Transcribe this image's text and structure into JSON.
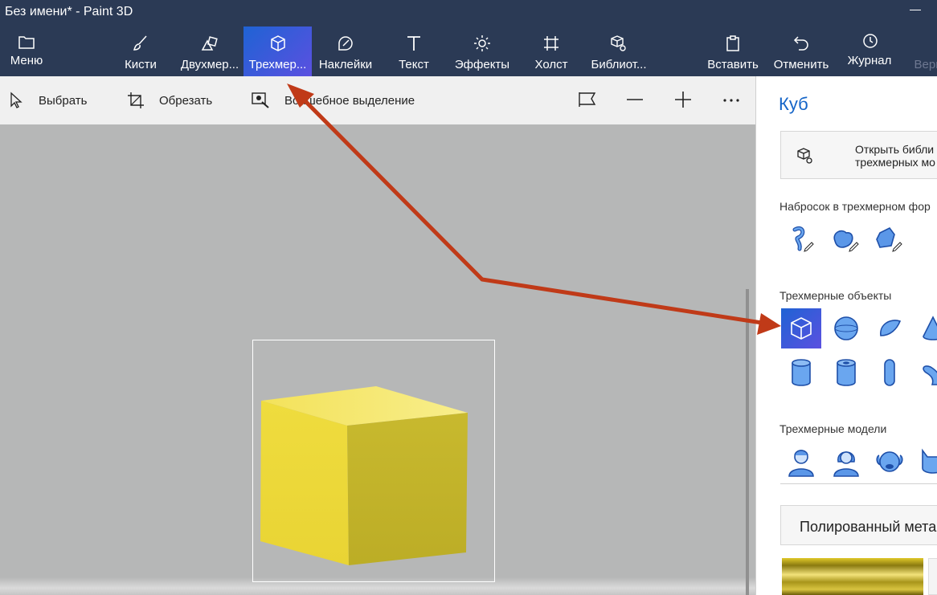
{
  "window": {
    "title": "Без имени* - Paint 3D"
  },
  "ribbon": {
    "menu": "Меню",
    "brushes": "Кисти",
    "shapes2d": "Двухмер...",
    "shapes3d": "Трехмер...",
    "stickers": "Наклейки",
    "text": "Текст",
    "effects": "Эффекты",
    "canvas": "Холст",
    "library": "Библиот...",
    "paste": "Вставить",
    "undo": "Отменить",
    "history": "Журнал",
    "redo": "Верн"
  },
  "toolbar": {
    "select": "Выбрать",
    "crop": "Обрезать",
    "magic_select": "Волшебное выделение"
  },
  "panel": {
    "title": "Куб",
    "library_button": "Открыть библи\nтрехмерных мо",
    "section_sketch": "Набросок в трехмерном фор",
    "section_objects": "Трехмерные объекты",
    "section_models": "Трехмерные модели",
    "material": "Полированный мета"
  },
  "colors": {
    "ribbon_bg": "#2b3a55",
    "accent": "#1f63d4",
    "arrow": "#c03a18",
    "cube_top": "#f5e878",
    "cube_front": "#efdb3b",
    "cube_side": "#c2b22a"
  },
  "icons": [
    "folder-icon",
    "brush-icon",
    "shapes-2d-icon",
    "cube-icon",
    "sticker-icon",
    "text-icon",
    "sun-icon",
    "canvas-icon",
    "library-icon",
    "paste-icon",
    "undo-icon",
    "history-icon",
    "cursor-icon",
    "crop-icon",
    "magic-select-icon",
    "view-icon",
    "zoom-out-icon",
    "zoom-in-icon",
    "more-icon"
  ]
}
